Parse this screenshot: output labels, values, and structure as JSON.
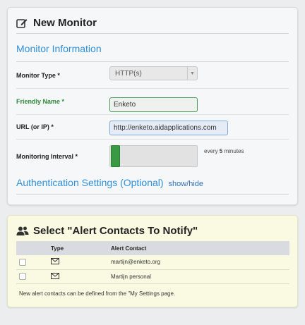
{
  "monitor_panel": {
    "title": "New Monitor",
    "title_icon": "edit-icon",
    "section_info": "Monitor Information",
    "fields": {
      "type": {
        "label": "Monitor Type *",
        "value": "HTTP(s)"
      },
      "name": {
        "label": "Friendly Name *",
        "value": "Enketo"
      },
      "url": {
        "label": "URL (or IP) *",
        "value": "http://enketo.aidapplications.com"
      },
      "interval": {
        "label": "Monitoring Interval *",
        "prefix": "every ",
        "value": "5",
        "suffix": " minutes",
        "slider_level": 0.0
      }
    },
    "section_auth": "Authentication Settings (Optional)",
    "auth_toggle": "show/hide"
  },
  "alerts_panel": {
    "title": "Select \"Alert Contacts To Notify\"",
    "title_icon": "users-icon",
    "columns": [
      "",
      "Type",
      "Alert Contact"
    ],
    "rows": [
      {
        "type_icon": "envelope-icon",
        "contact": "martijn@enketo.org"
      },
      {
        "type_icon": "envelope-icon",
        "contact": "Martijn personal"
      }
    ],
    "footnote": "New alert contacts can be defined from the \"My Settings page."
  },
  "colors": {
    "heading_blue": "#2f8fd8",
    "green": "#3a9a43",
    "alerts_bg": "#fafae3",
    "panel_bg": "#f6f7f9"
  }
}
